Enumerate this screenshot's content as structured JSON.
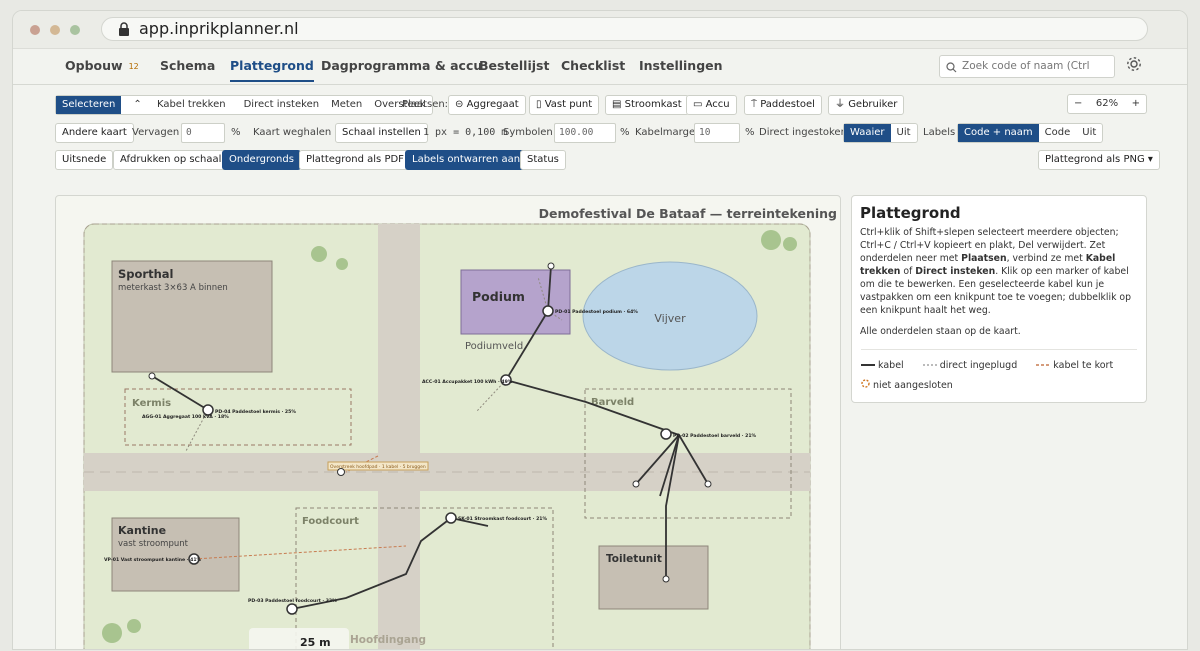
{
  "browser": {
    "url": "app.inprikplanner.nl"
  },
  "nav": {
    "tabs": [
      {
        "label": "Opbouw",
        "badge": "12"
      },
      {
        "label": "Schema"
      },
      {
        "label": "Plattegrond"
      },
      {
        "label": "Dagprogramma & accu"
      },
      {
        "label": "Bestellijst"
      },
      {
        "label": "Checklist"
      },
      {
        "label": "Instellingen"
      }
    ],
    "search_placeholder": "Zoek code of naam (Ctrl"
  },
  "toolbar1": {
    "modes": [
      "Selecteren",
      "Kabel trekken",
      "Direct insteken",
      "Meten",
      "Oversteek"
    ],
    "place_label": "Plaatsen:",
    "place_buttons": [
      "Aggregaat",
      "Vast punt",
      "Stroomkast",
      "Accu",
      "Paddestoel",
      "Gebruiker"
    ],
    "zoom": "62%",
    "zoom_minus": "−",
    "zoom_plus": "+"
  },
  "toolbar2": {
    "other_map": "Andere kaart",
    "fade_label": "Vervagen",
    "fade_value": "0",
    "pct": "%",
    "remove_map": "Kaart weghalen",
    "set_scale": "Schaal instellen",
    "scale_text": "1 px = 0,100 m",
    "symbols_label": "Symbolen",
    "symbols_value": "100.00",
    "cable_margin_label": "Kabelmarge",
    "cable_margin_value": "10",
    "direct_label": "Direct ingestoken",
    "direct_opts": [
      "Waaier",
      "Uit"
    ],
    "labels_label": "Labels",
    "labels_opts": [
      "Code + naam",
      "Code",
      "Uit"
    ]
  },
  "toolbar3": {
    "buttons": [
      "Uitsnede",
      "Afdrukken op schaal",
      "Ondergronds",
      "Plattegrond als PDF",
      "Labels ontwarren aan",
      "Status"
    ],
    "export_png": "Plattegrond als PNG ▾"
  },
  "map": {
    "title": "Demofestival De Bataaf — terreintekening",
    "areas": {
      "sporthal": {
        "name": "Sporthal",
        "sub": "meterkast 3×63 A binnen"
      },
      "kermis": "Kermis",
      "podium": "Podium",
      "podiumveld": "Podiumveld",
      "vijver": "Vijver",
      "barveld": "Barveld",
      "kantine": {
        "name": "Kantine",
        "sub": "vast stroompunt"
      },
      "foodcourt": "Foodcourt",
      "toiletunit": "Toiletunit",
      "hoofdingang": "Hoofdingang"
    },
    "nodes": {
      "pd_podium": "PD-01 Paddestoel podium · 64%",
      "acc": "ACC-01 Accupakket 100 kWh · 49%",
      "pd_kermis": "PD-04 Paddestoel kermis · 25%",
      "agg": "AGG-01 Aggregaat 100 kVA · 18%",
      "pd_bar": "PD-02 Paddestoel barveld · 21%",
      "sk_food": "SK-01 Stroomkast foodcourt · 21%",
      "vp_kantine": "VP-01 Vast stroompunt kantine · 41%",
      "pd_food": "PD-03 Paddestoel foodcourt · 32%",
      "crossing": "Overstreek hoofdpad · 1 kabel · 5 bruggen"
    },
    "scale_bar": "25 m"
  },
  "panel": {
    "title": "Plattegrond",
    "p1_a": "Ctrl+klik of Shift+slepen selecteert meerdere objecten; Ctrl+C / Ctrl+V kopieert en plakt, Del verwijdert. Zet onderdelen neer met ",
    "p1_b": "Plaatsen",
    "p1_c": ", verbind ze met ",
    "p1_d": "Kabel trekken",
    "p1_e": " of ",
    "p1_f": "Direct insteken",
    "p1_g": ". Klik op een marker of kabel om die te bewerken. Een geselecteerde kabel kun je vastpakken om een knikpunt toe te voegen; dubbelklik op een knikpunt haalt het weg.",
    "p2": "Alle onderdelen staan op de kaart.",
    "legend": {
      "cable": "kabel",
      "direct": "direct ingeplugd",
      "short": "kabel te kort",
      "unconnected": "niet aangesloten"
    }
  },
  "colors": {
    "accent": "#1f4e87",
    "grass": "#e2ead1",
    "path": "#d6d1c7",
    "podium": "#b5a3cc",
    "pond": "#bcd6e8",
    "building": "#c6bfb3"
  }
}
